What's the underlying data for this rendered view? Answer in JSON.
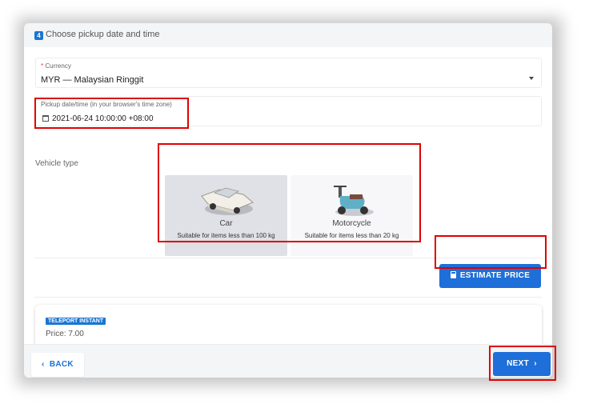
{
  "header": {
    "step_number": "4",
    "title": "Choose pickup date and time"
  },
  "currency": {
    "label": "Currency",
    "required_mark": "*",
    "value": "MYR — Malaysian Ringgit"
  },
  "pickup": {
    "label": "Pickup date/time (in your browser's time zone)",
    "value": "2021-06-24 10:00:00 +08:00"
  },
  "vehicle_type": {
    "label": "Vehicle type",
    "options": [
      {
        "name": "Car",
        "description": "Suitable for items less than 100 kg",
        "selected": true
      },
      {
        "name": "Motorcycle",
        "description": "Suitable for items less than 20 kg",
        "selected": false
      }
    ]
  },
  "estimate_button": {
    "label": "ESTIMATE PRICE"
  },
  "quote": {
    "service": "TELEPORT INSTANT",
    "price": "Price: 7.00"
  },
  "footer": {
    "back_label": "BACK",
    "next_label": "NEXT"
  },
  "colors": {
    "accent": "#1e6fd9",
    "highlight": "#e00000",
    "selected_card": "#dfe1e6"
  }
}
